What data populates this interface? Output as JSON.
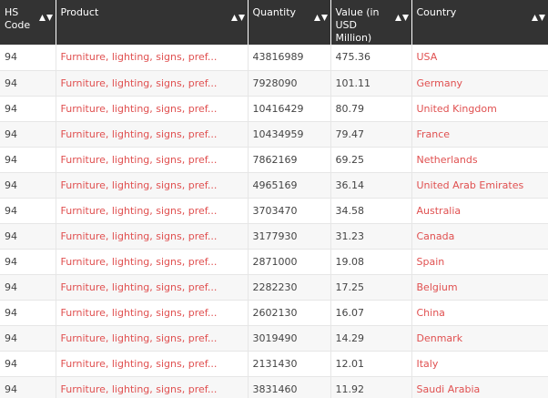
{
  "columns": [
    {
      "label": "HS Code"
    },
    {
      "label": "Product"
    },
    {
      "label": "Quantity"
    },
    {
      "label": "Value (in USD Million)"
    },
    {
      "label": "Country"
    }
  ],
  "rows": [
    {
      "hs": "94",
      "product": "Furniture, lighting, signs, pref...",
      "quantity": "43816989",
      "value": "475.36",
      "country": "USA"
    },
    {
      "hs": "94",
      "product": "Furniture, lighting, signs, pref...",
      "quantity": "7928090",
      "value": "101.11",
      "country": "Germany"
    },
    {
      "hs": "94",
      "product": "Furniture, lighting, signs, pref...",
      "quantity": "10416429",
      "value": "80.79",
      "country": "United Kingdom"
    },
    {
      "hs": "94",
      "product": "Furniture, lighting, signs, pref...",
      "quantity": "10434959",
      "value": "79.47",
      "country": "France"
    },
    {
      "hs": "94",
      "product": "Furniture, lighting, signs, pref...",
      "quantity": "7862169",
      "value": "69.25",
      "country": "Netherlands"
    },
    {
      "hs": "94",
      "product": "Furniture, lighting, signs, pref...",
      "quantity": "4965169",
      "value": "36.14",
      "country": "United Arab Emirates"
    },
    {
      "hs": "94",
      "product": "Furniture, lighting, signs, pref...",
      "quantity": "3703470",
      "value": "34.58",
      "country": "Australia"
    },
    {
      "hs": "94",
      "product": "Furniture, lighting, signs, pref...",
      "quantity": "3177930",
      "value": "31.23",
      "country": "Canada"
    },
    {
      "hs": "94",
      "product": "Furniture, lighting, signs, pref...",
      "quantity": "2871000",
      "value": "19.08",
      "country": "Spain"
    },
    {
      "hs": "94",
      "product": "Furniture, lighting, signs, pref...",
      "quantity": "2282230",
      "value": "17.25",
      "country": "Belgium"
    },
    {
      "hs": "94",
      "product": "Furniture, lighting, signs, pref...",
      "quantity": "2602130",
      "value": "16.07",
      "country": "China"
    },
    {
      "hs": "94",
      "product": "Furniture, lighting, signs, pref...",
      "quantity": "3019490",
      "value": "14.29",
      "country": "Denmark"
    },
    {
      "hs": "94",
      "product": "Furniture, lighting, signs, pref...",
      "quantity": "2131430",
      "value": "12.01",
      "country": "Italy"
    },
    {
      "hs": "94",
      "product": "Furniture, lighting, signs, pref...",
      "quantity": "3831460",
      "value": "11.92",
      "country": "Saudi Arabia"
    }
  ],
  "colors": {
    "header_bg": "#333333",
    "link": "#e05050",
    "row_alt": "#f7f7f7"
  }
}
